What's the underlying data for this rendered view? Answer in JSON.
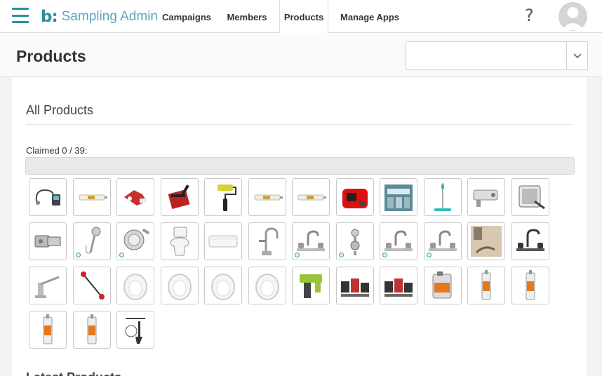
{
  "app": {
    "logo_mark": "b:",
    "logo_text": "Sampling Admin"
  },
  "nav": {
    "tabs": [
      {
        "label": "Campaigns",
        "active": false
      },
      {
        "label": "Members",
        "active": false
      },
      {
        "label": "Products",
        "active": true
      },
      {
        "label": "Manage Apps",
        "active": false
      }
    ],
    "help_glyph": "?",
    "help_icon": "question-icon",
    "avatar_icon": "user-avatar-icon"
  },
  "page": {
    "title": "Products",
    "filter_select": {
      "value": "",
      "icon": "chevron-down-icon"
    }
  },
  "section": {
    "title": "All Products",
    "claimed_label": "Claimed 0 / 39:",
    "claimed": 0,
    "total": 39,
    "next_title": "Latest Products"
  },
  "colors": {
    "accent": "#2a8fa3",
    "tile_border": "#c8c8c8",
    "progress_bg": "#e9e9e9"
  },
  "products": [
    {
      "icon": "inspection-camera-icon",
      "badge": false
    },
    {
      "icon": "caulk-tube-icon",
      "badge": false
    },
    {
      "icon": "red-tool-icon",
      "badge": false
    },
    {
      "icon": "scraper-icon",
      "badge": false
    },
    {
      "icon": "paint-roller-icon",
      "badge": false
    },
    {
      "icon": "caulk-tube-icon",
      "badge": false
    },
    {
      "icon": "caulk-tube-icon",
      "badge": false
    },
    {
      "icon": "generator-icon",
      "badge": false
    },
    {
      "icon": "product-box-icon",
      "badge": false
    },
    {
      "icon": "spray-mop-icon",
      "badge": false
    },
    {
      "icon": "drywall-tool-icon",
      "badge": false
    },
    {
      "icon": "tool-case-icon",
      "badge": false
    },
    {
      "icon": "cabinet-hinge-icon",
      "badge": false
    },
    {
      "icon": "handheld-shower-icon",
      "badge": true
    },
    {
      "icon": "shower-head-icon",
      "badge": true
    },
    {
      "icon": "toilet-icon",
      "badge": false
    },
    {
      "icon": "bathtub-icon",
      "badge": false
    },
    {
      "icon": "kitchen-faucet-icon",
      "badge": false
    },
    {
      "icon": "bathroom-faucet-icon",
      "badge": true
    },
    {
      "icon": "shower-valve-icon",
      "badge": true
    },
    {
      "icon": "bathroom-faucet-icon",
      "badge": true
    },
    {
      "icon": "bathroom-faucet-icon",
      "badge": true
    },
    {
      "icon": "bathroom-photo-icon",
      "badge": false
    },
    {
      "icon": "dark-faucet-icon",
      "badge": false
    },
    {
      "icon": "chrome-faucet-icon",
      "badge": false
    },
    {
      "icon": "string-trimmer-icon",
      "badge": false
    },
    {
      "icon": "toilet-seat-icon",
      "badge": false
    },
    {
      "icon": "toilet-seat-icon",
      "badge": false
    },
    {
      "icon": "toilet-seat-icon",
      "badge": false
    },
    {
      "icon": "toilet-seat-icon",
      "badge": false
    },
    {
      "icon": "nail-gun-icon",
      "badge": false
    },
    {
      "icon": "power-tool-kit-icon",
      "badge": false
    },
    {
      "icon": "power-tool-kit-icon",
      "badge": false
    },
    {
      "icon": "sealant-jug-icon",
      "badge": false
    },
    {
      "icon": "sealant-tube-icon",
      "badge": false
    },
    {
      "icon": "sealant-tube-icon",
      "badge": false
    },
    {
      "icon": "sealant-tube-icon",
      "badge": false
    },
    {
      "icon": "sealant-tube-icon",
      "badge": false
    },
    {
      "icon": "garden-tools-icon",
      "badge": false
    }
  ]
}
